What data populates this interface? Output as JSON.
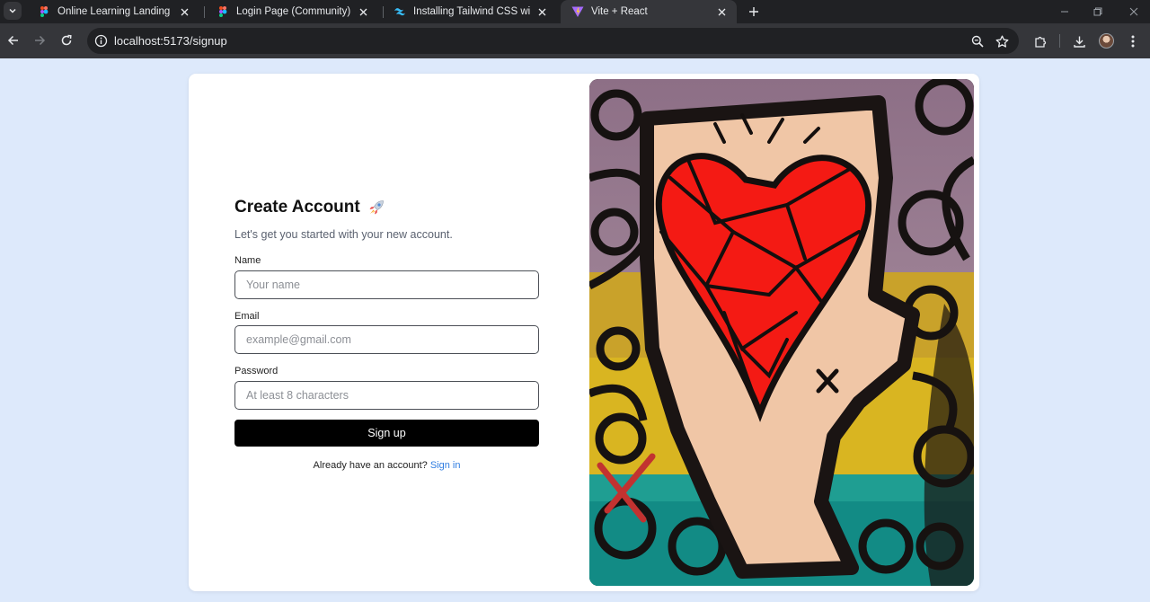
{
  "browser": {
    "tabs": [
      {
        "title": "Online Learning Landing Page (",
        "favicon": "figma-icon",
        "active": false
      },
      {
        "title": "Login Page (Community) – Figm",
        "favicon": "figma-icon",
        "active": false
      },
      {
        "title": "Installing Tailwind CSS with Vite",
        "favicon": "tailwind-icon",
        "active": false
      },
      {
        "title": "Vite + React",
        "favicon": "vite-icon",
        "active": true
      }
    ],
    "url": "localhost:5173/signup"
  },
  "signup": {
    "title": "Create Account",
    "title_emoji": "rocket-icon",
    "subtitle": "Let's get you started with your new account.",
    "fields": {
      "name": {
        "label": "Name",
        "placeholder": "Your name",
        "value": ""
      },
      "email": {
        "label": "Email",
        "placeholder": "example@gmail.com",
        "value": ""
      },
      "password": {
        "label": "Password",
        "placeholder": "At least 8 characters",
        "value": ""
      }
    },
    "submit_label": "Sign up",
    "footer_text": "Already have an account?",
    "footer_link": "Sign in"
  },
  "colors": {
    "page_bg": "#dde9fb",
    "button_bg": "#000000",
    "link": "#2f7de1",
    "heart": "#f41a14"
  }
}
